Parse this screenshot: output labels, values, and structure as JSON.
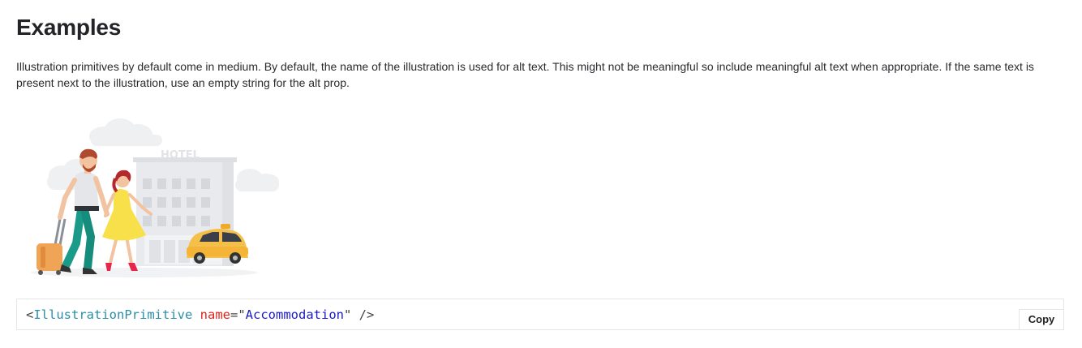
{
  "section": {
    "title": "Examples",
    "description": "Illustration primitives by default come in medium. By default, the name of the illustration is used for alt text. This might not be meaningful so include meaningful alt text when appropriate. If the same text is present next to the illustration, use an empty string for the alt prop."
  },
  "illustration": {
    "name": "Accommodation",
    "sign_text": "HOTEL"
  },
  "code": {
    "open": "<",
    "tag": "IllustrationPrimitive",
    "attr": "name",
    "eq": "=",
    "quote_open": "\"",
    "value": "Accommodation",
    "quote_close": "\"",
    "close": " />"
  },
  "copy_button": {
    "label": "Copy"
  }
}
